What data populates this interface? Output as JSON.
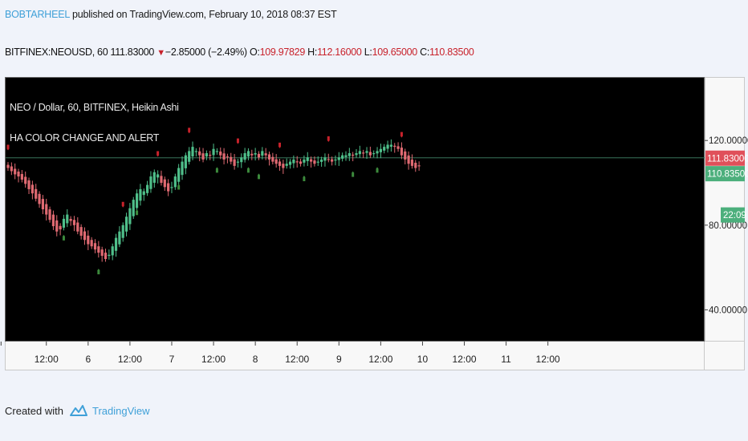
{
  "header": {
    "author": "BOBTARHEEL",
    "published_text": " published on TradingView.com, February 10, 2018 08:37 EST"
  },
  "quote": {
    "symbol_text": "BITFINEX:NEOUSD, 60 111.83000",
    "arrow": "▼",
    "change": "−2.85000 (−2.49%)",
    "o_label": "O:",
    "o_value": "109.97829",
    "h_label": "H:",
    "h_value": "112.16000",
    "l_label": "L:",
    "l_value": "109.65000",
    "c_label": "C:",
    "c_value": "110.83500"
  },
  "legend": {
    "series_title": "NEO / Dollar, 60, BITFINEX, Heikin Ashi",
    "indicator_title": "HA COLOR CHANGE AND ALERT"
  },
  "footer": {
    "created_with": "Created with",
    "brand": "TradingView"
  },
  "colors": {
    "up": "#4fbf8a",
    "down": "#e06a72",
    "price_tag_red": "#e0505a",
    "price_tag_green": "#4caf7c",
    "price_line": "#2e5e4a",
    "buy_arrow": "#3c8a3c",
    "sell_arrow": "#c8222b"
  },
  "chart_data": {
    "type": "candlestick",
    "ylim": [
      25,
      150
    ],
    "yticks": [
      {
        "value": 120,
        "label": "120.00000"
      },
      {
        "value": 80,
        "label": "80.00000"
      },
      {
        "value": 40,
        "label": "40.00000"
      }
    ],
    "xticks": [
      {
        "bar": -2,
        "label": ""
      },
      {
        "bar": 11,
        "label": "12:00"
      },
      {
        "bar": 23,
        "label": "6"
      },
      {
        "bar": 35,
        "label": "12:00"
      },
      {
        "bar": 47,
        "label": "7"
      },
      {
        "bar": 59,
        "label": "12:00"
      },
      {
        "bar": 71,
        "label": "8"
      },
      {
        "bar": 83,
        "label": "12:00"
      },
      {
        "bar": 95,
        "label": "9"
      },
      {
        "bar": 107,
        "label": "12:00"
      },
      {
        "bar": 119,
        "label": "10"
      },
      {
        "bar": 131,
        "label": "12:00"
      },
      {
        "bar": 143,
        "label": "11"
      },
      {
        "bar": 155,
        "label": "12:00"
      }
    ],
    "bars_total": 158,
    "last_price": {
      "value": 111.83,
      "label": "111.83000"
    },
    "close_price": {
      "value": 104.5,
      "label": "110.83500"
    },
    "countdown": {
      "value": 85,
      "label": "22:09"
    },
    "closes": [
      107,
      105.5,
      104,
      103,
      101.5,
      99.5,
      97,
      95,
      92.5,
      90,
      87.5,
      85,
      82.5,
      79.5,
      77,
      78,
      83,
      85,
      82,
      80,
      77,
      75,
      73,
      71,
      70,
      68.5,
      67,
      65.5,
      64,
      66,
      70,
      74,
      77,
      80,
      84,
      88,
      92,
      95,
      97,
      96,
      99,
      103,
      105,
      104,
      100,
      98,
      96,
      98,
      103,
      107,
      110,
      113,
      115,
      117,
      115,
      113,
      111,
      114,
      113,
      116,
      115,
      113,
      111,
      112,
      110,
      108,
      110,
      112,
      114,
      115,
      113,
      114,
      112,
      115,
      113,
      111,
      110,
      109,
      108,
      107,
      109,
      110,
      111,
      110,
      109,
      111,
      112,
      110,
      109,
      110,
      111,
      112,
      111,
      110,
      111,
      112,
      113,
      113,
      114,
      113,
      114,
      115,
      114,
      115,
      113,
      114,
      115,
      116,
      117,
      118,
      118,
      117,
      116,
      113,
      111,
      109,
      108,
      107,
      108
    ]
  }
}
